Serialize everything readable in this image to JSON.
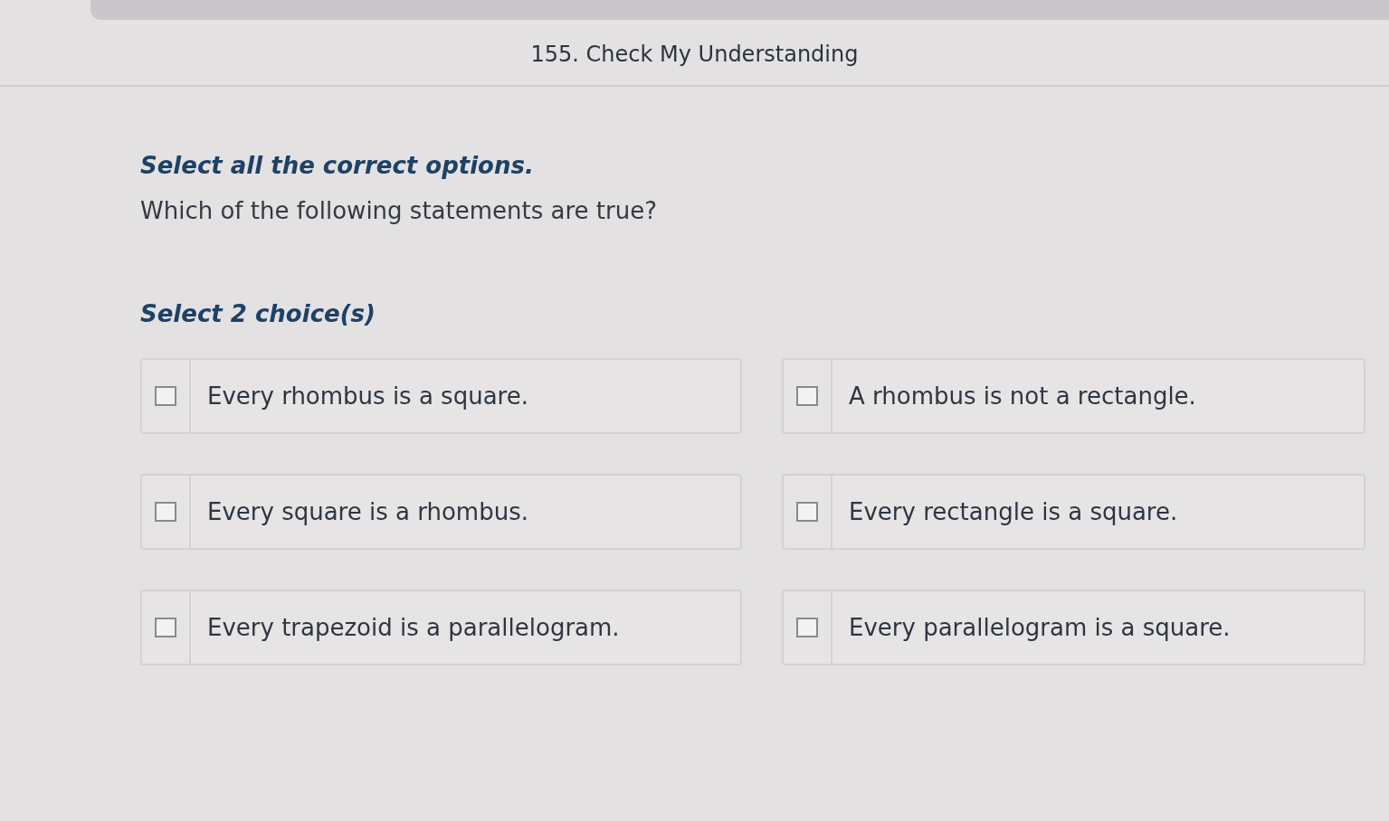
{
  "header": {
    "title": "155. Check My Understanding"
  },
  "instruction": "Select all the correct options.",
  "question": "Which of the following statements are true?",
  "choice_count": "Select 2 choice(s)",
  "options": [
    {
      "label": "Every rhombus is a square.",
      "checked": false
    },
    {
      "label": "A rhombus is not a rectangle.",
      "checked": false
    },
    {
      "label": "Every square is a rhombus.",
      "checked": false
    },
    {
      "label": "Every rectangle is a square.",
      "checked": false
    },
    {
      "label": "Every trapezoid is a parallelogram.",
      "checked": false
    },
    {
      "label": "Every parallelogram is a square.",
      "checked": false
    }
  ]
}
